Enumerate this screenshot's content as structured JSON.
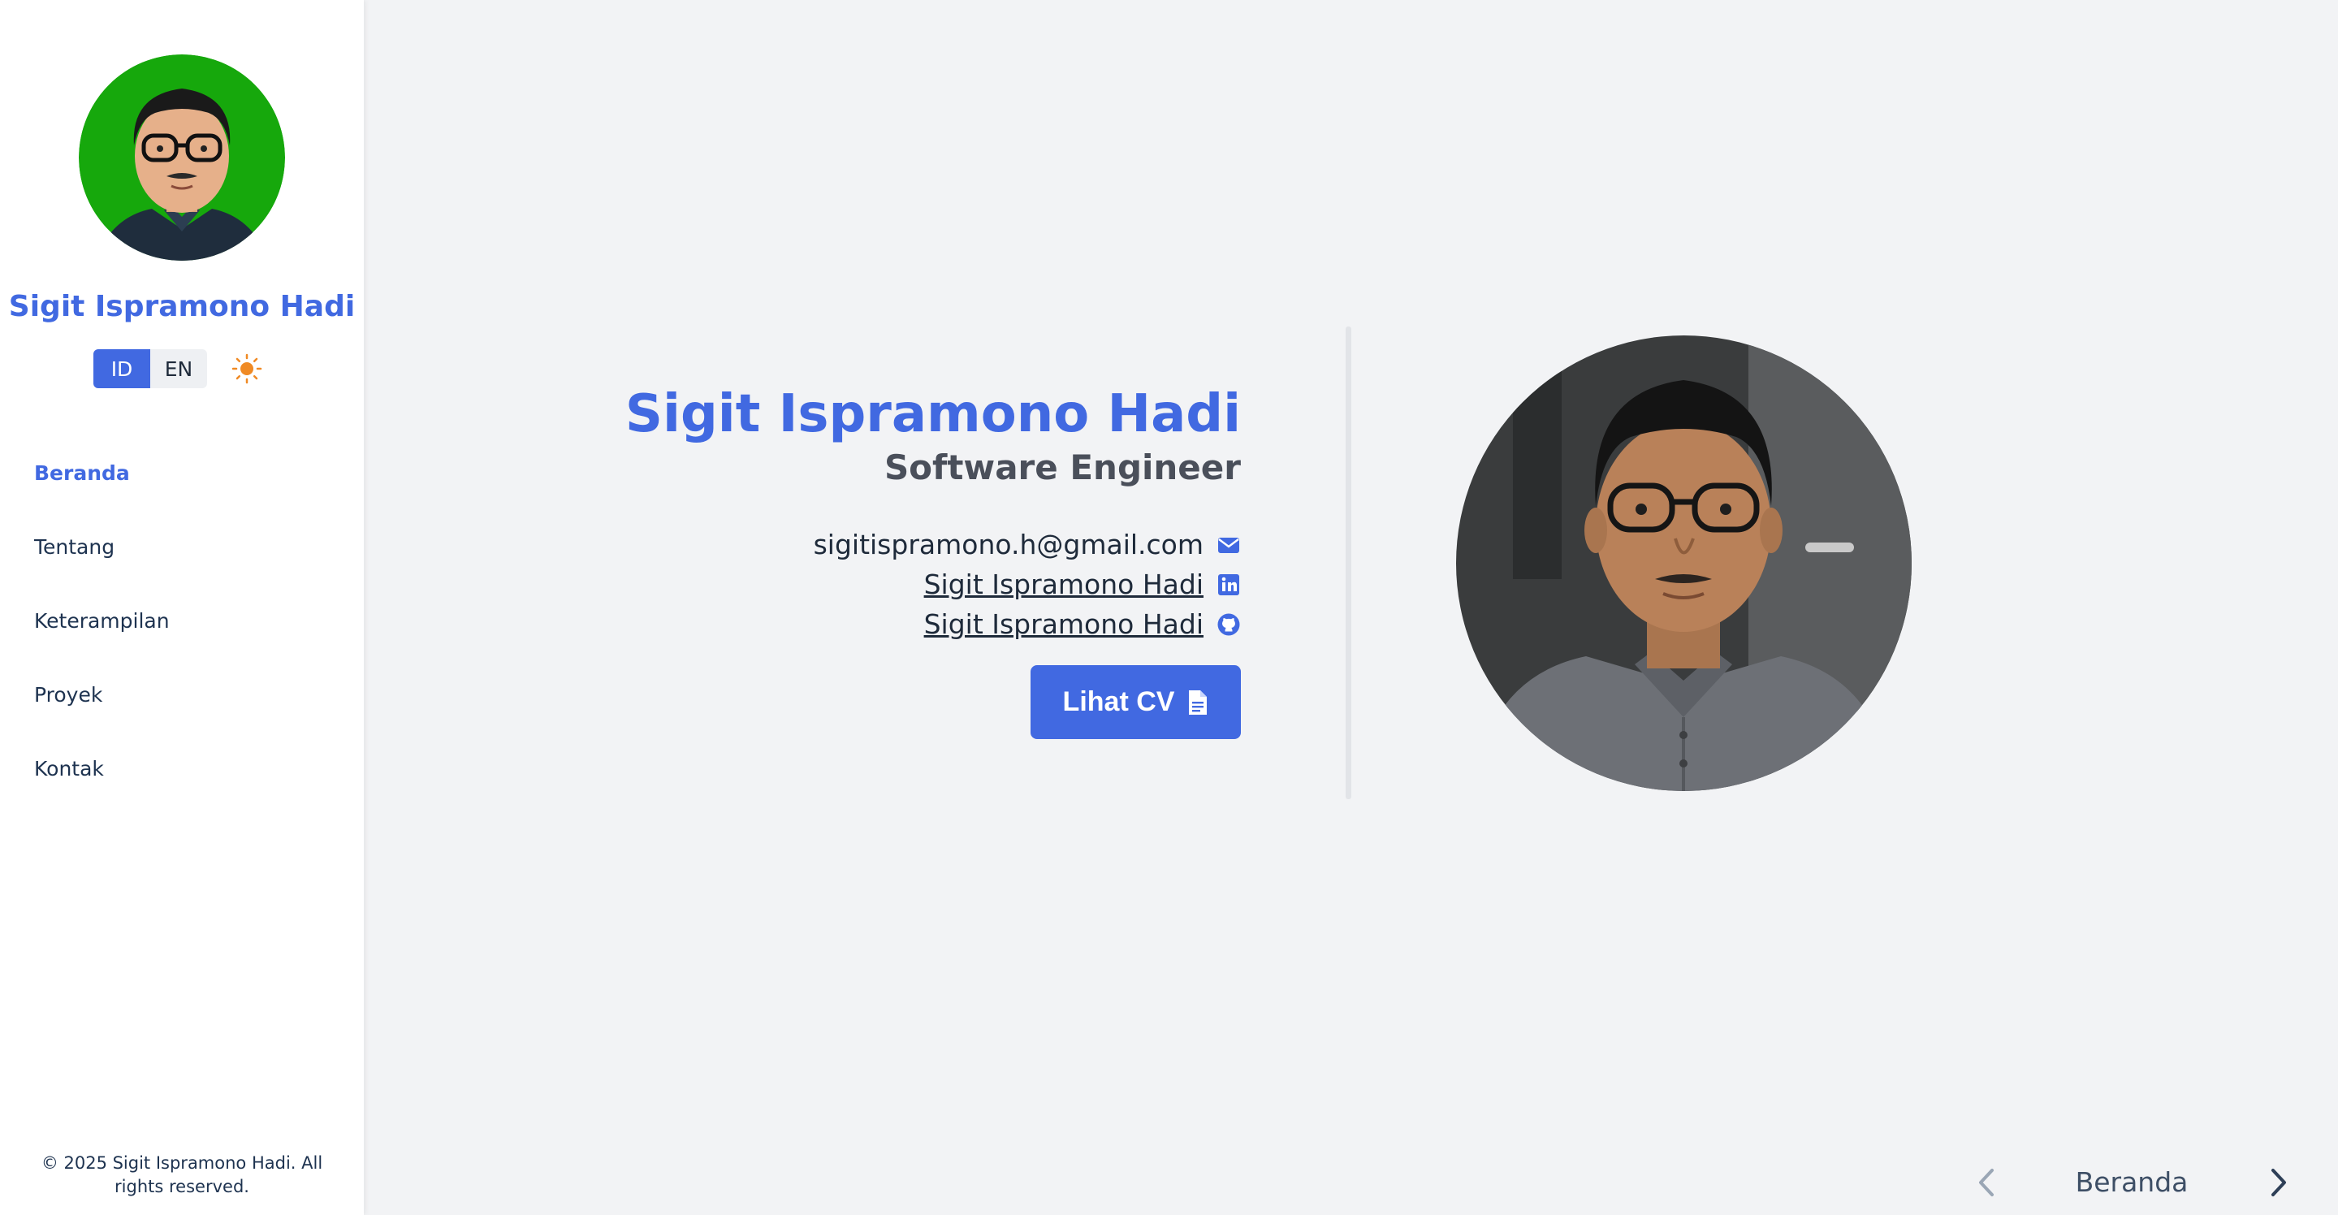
{
  "sidebar": {
    "avatar_alt": "Sigit Ispramono Hadi avatar",
    "name": "Sigit Ispramono Hadi",
    "lang": {
      "id": "ID",
      "en": "EN",
      "active": "ID"
    },
    "theme_icon": "sun-icon",
    "nav": [
      {
        "label": "Beranda",
        "active": true
      },
      {
        "label": "Tentang",
        "active": false
      },
      {
        "label": "Keterampilan",
        "active": false
      },
      {
        "label": "Proyek",
        "active": false
      },
      {
        "label": "Kontak",
        "active": false
      }
    ],
    "footer": "© 2025 Sigit Ispramono Hadi. All rights reserved."
  },
  "hero": {
    "name": "Sigit Ispramono Hadi",
    "role": "Software Engineer",
    "contacts": {
      "email": "sigitispramono.h@gmail.com",
      "linkedin": "Sigit Ispramono Hadi",
      "github": "Sigit Ispramono Hadi"
    },
    "cv_button": "Lihat CV"
  },
  "pager": {
    "current": "Beranda"
  },
  "colors": {
    "accent": "#4169e1",
    "background": "#f2f3f5",
    "sun": "#f08a24",
    "avatar_bg": "#16a80c"
  }
}
